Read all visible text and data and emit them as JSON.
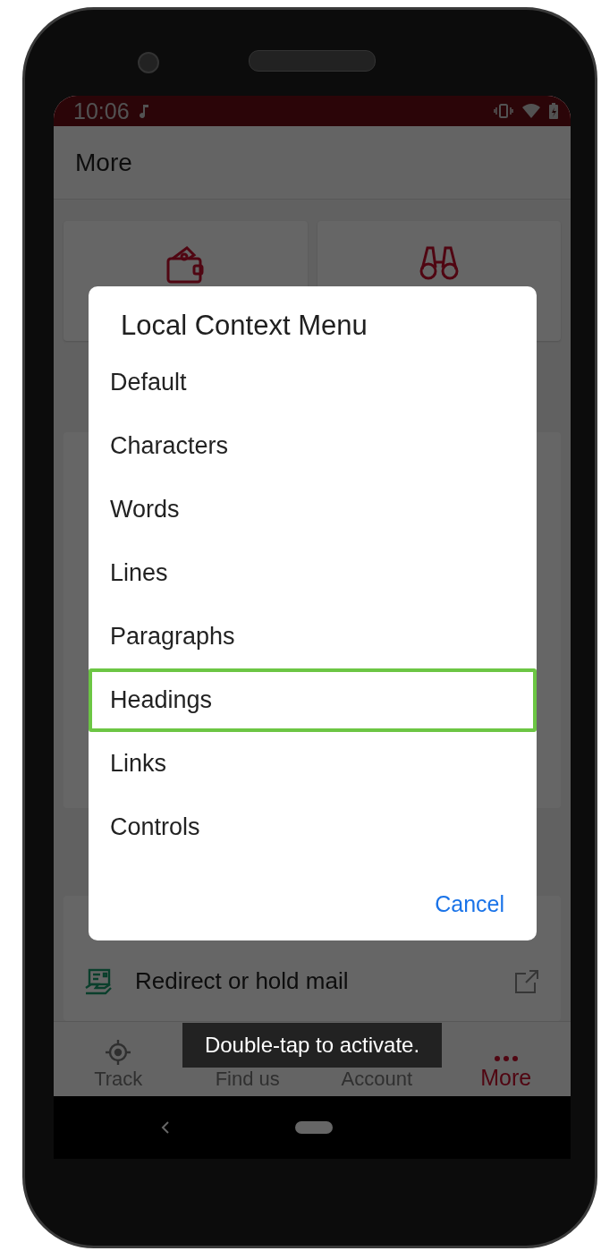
{
  "status_bar": {
    "time": "10:06"
  },
  "app_bar": {
    "title": "More"
  },
  "list": [
    {
      "label": "Redirect or hold mail"
    }
  ],
  "bottom_nav": [
    {
      "label": "Track",
      "selected": false
    },
    {
      "label": "Find us",
      "selected": false
    },
    {
      "label": "Account",
      "selected": false
    },
    {
      "label": "More",
      "selected": true
    }
  ],
  "dialog": {
    "title": "Local Context Menu",
    "items": [
      {
        "label": "Default",
        "focused": false
      },
      {
        "label": "Characters",
        "focused": false
      },
      {
        "label": "Words",
        "focused": false
      },
      {
        "label": "Lines",
        "focused": false
      },
      {
        "label": "Paragraphs",
        "focused": false
      },
      {
        "label": "Headings",
        "focused": true
      },
      {
        "label": "Links",
        "focused": false
      },
      {
        "label": "Controls",
        "focused": false
      }
    ],
    "cancel": "Cancel"
  },
  "toast": "Double-tap to activate."
}
